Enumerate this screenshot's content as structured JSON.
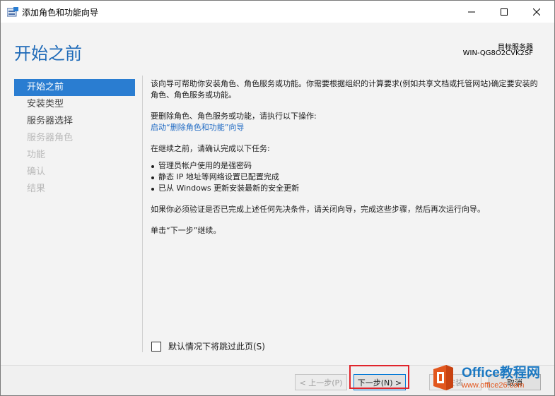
{
  "window": {
    "title": "添加角色和功能向导"
  },
  "header": {
    "page_title": "开始之前",
    "server_label": "目标服务器",
    "server_name": "WIN-QG8O2CVK2SF"
  },
  "nav": {
    "items": [
      {
        "label": "开始之前",
        "state": "active"
      },
      {
        "label": "安装类型",
        "state": "enabled"
      },
      {
        "label": "服务器选择",
        "state": "enabled"
      },
      {
        "label": "服务器角色",
        "state": "disabled"
      },
      {
        "label": "功能",
        "state": "disabled"
      },
      {
        "label": "确认",
        "state": "disabled"
      },
      {
        "label": "结果",
        "state": "disabled"
      }
    ]
  },
  "content": {
    "intro": "该向导可帮助你安装角色、角色服务或功能。你需要根据组织的计算要求(例如共享文档或托管网站)确定要安装的角色、角色服务或功能。",
    "remove_text": "要删除角色、角色服务或功能，请执行以下操作:",
    "remove_link": "启动“删除角色和功能”向导",
    "before_text": "在继续之前，请确认完成以下任务:",
    "bullets": [
      "管理员帐户使用的是强密码",
      "静态 IP 地址等网络设置已配置完成",
      "已从 Windows 更新安装最新的安全更新"
    ],
    "verify_text": "如果你必须验证是否已完成上述任何先决条件，请关闭向导，完成这些步骤，然后再次运行向导。",
    "next_hint": "单击“下一步”继续。"
  },
  "skip_checkbox": {
    "label": "默认情况下将跳过此页(S)",
    "checked": false
  },
  "footer": {
    "prev_label": "< 上一步(P)",
    "next_label": "下一步(N) >",
    "install_label": "安装",
    "cancel_label": "取消"
  },
  "watermark": {
    "brand": "Office教程网",
    "url": "www.office26.com"
  },
  "colors": {
    "accent": "#2a7dd1",
    "title": "#1e6ab8",
    "link": "#1b67c3",
    "highlight": "#e0242b"
  }
}
